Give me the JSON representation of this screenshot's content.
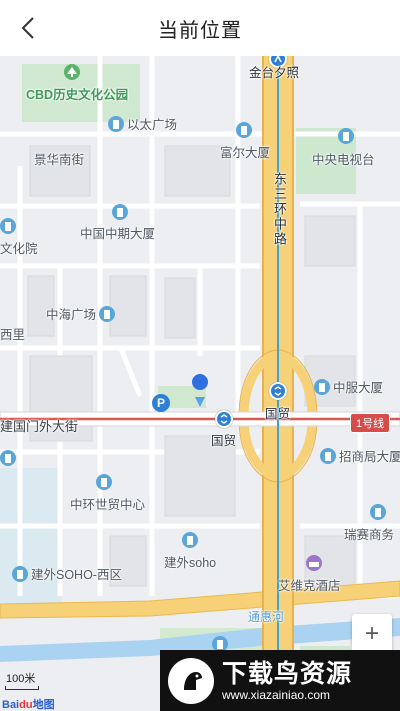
{
  "header": {
    "title": "当前位置"
  },
  "map": {
    "parks": [
      "CBD历史文化公园"
    ],
    "pois": [
      {
        "id": "yitai",
        "label": "以太广场",
        "icon": "building-icon"
      },
      {
        "id": "fuer",
        "label": "富尔大厦",
        "icon": "building-icon"
      },
      {
        "id": "cctv",
        "label": "中央电视台",
        "icon": "building-icon"
      },
      {
        "id": "zhongqi",
        "label": "中国中期大厦",
        "icon": "building-icon"
      },
      {
        "id": "zhonghai",
        "label": "中海广场",
        "icon": "building-icon"
      },
      {
        "id": "zhongfu",
        "label": "中服大厦",
        "icon": "building-icon"
      },
      {
        "id": "zhaoshang",
        "label": "招商局大厦",
        "icon": "building-icon"
      },
      {
        "id": "shimao",
        "label": "中环世贸中心",
        "icon": "building-icon"
      },
      {
        "id": "ruisai",
        "label": "瑞赛商务",
        "icon": "building-icon"
      },
      {
        "id": "jwsoho",
        "label": "建外soho",
        "icon": "building-icon"
      },
      {
        "id": "jwsoho-w",
        "label": "建外SOHO-西区",
        "icon": "building-icon"
      },
      {
        "id": "aiweike",
        "label": "艾维克酒店",
        "icon": "hotel-icon"
      }
    ],
    "areas": [
      "景华南街",
      "文化院",
      "西里"
    ],
    "roads": {
      "jianguomen": "建国门外大街",
      "east_third_ring": "东三环中路"
    },
    "stations": {
      "jintaixizhao": "金台夕照",
      "guomao_north": "国贸",
      "guomao_main": "国贸"
    },
    "line_badge": "1号线",
    "river": "通惠河",
    "parking_label": "P"
  },
  "controls": {
    "zoom_in": "+"
  },
  "scale": {
    "label": "100米"
  },
  "logo": {
    "text_a": "Bai",
    "text_b": "du",
    "text_c": "地图"
  },
  "watermark": {
    "title": "下载鸟资源",
    "url": "www.xiazainiao.com"
  }
}
